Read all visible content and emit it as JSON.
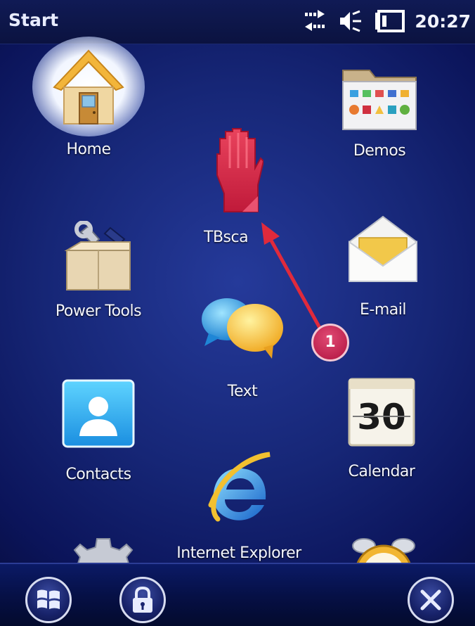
{
  "topbar": {
    "title": "Start",
    "clock": "20:27"
  },
  "tiles": [
    {
      "label": "Home",
      "icon": "home-icon"
    },
    {
      "label": "TBsca",
      "icon": "hand-icon"
    },
    {
      "label": "Demos",
      "icon": "folder-icon"
    },
    {
      "label": "Power Tools",
      "icon": "toolbox-icon"
    },
    {
      "label": "E-mail",
      "icon": "envelope-icon"
    },
    {
      "label": "Text",
      "icon": "chat-bubbles-icon"
    },
    {
      "label": "Contacts",
      "icon": "contact-icon"
    },
    {
      "label": "Calendar",
      "icon": "calendar-icon",
      "day": "30"
    },
    {
      "label": "Internet Explorer",
      "icon": "internet-explorer-icon"
    }
  ],
  "annotation": {
    "badge": "1",
    "color": "#e02a3c"
  },
  "colors": {
    "background": "#162676",
    "badge": "#c21848"
  }
}
